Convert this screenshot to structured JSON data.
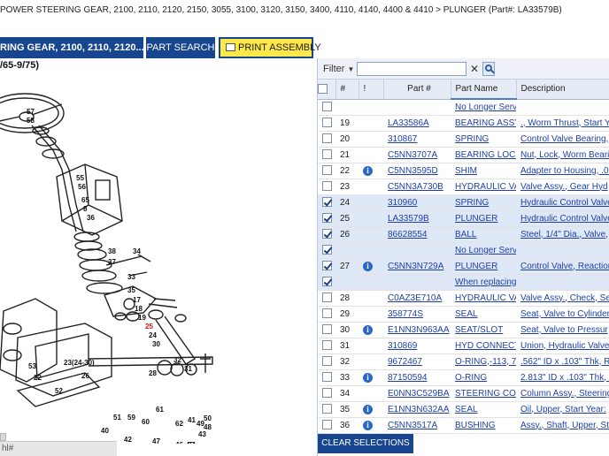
{
  "breadcrumb": "POWER STEERING GEAR, 2100, 2110, 2120, 2150, 3055, 3100, 3120, 3150, 3400, 4110, 4140, 4400 & 4410 > PLUNGER (Part#: LA33579B)",
  "toolbar": {
    "assembly_label": "RING GEAR, 2100, 2110, 2120...",
    "part_search_label": "PART SEARCH",
    "print_label": "PRINT ASSEMBLY"
  },
  "diagram": {
    "date_range": "/65-9/75)",
    "callouts": [
      "57",
      "58",
      "55",
      "56",
      "65",
      "8",
      "36",
      "38",
      "37",
      "34",
      "33",
      "35",
      "17",
      "18",
      "19",
      "25",
      "24",
      "30",
      "26",
      "23(24-30)",
      "32",
      "31",
      "28",
      "53",
      "22",
      "52",
      "61",
      "51",
      "59",
      "60",
      "62",
      "63",
      "41",
      "42",
      "47",
      "46",
      "45",
      "43",
      "49",
      "48",
      "50",
      "64",
      "40"
    ],
    "highlight_callout": "25",
    "scroll_text": "hl#"
  },
  "filter": {
    "label": "Filter",
    "placeholder": ""
  },
  "grid": {
    "columns": [
      "#",
      "!",
      "Part #",
      "Part Name",
      "Description"
    ],
    "rows": [
      {
        "checked": false,
        "num": "",
        "info": false,
        "part": "",
        "name": "No Longer Serv",
        "desc": "",
        "selected": false
      },
      {
        "checked": false,
        "num": "19",
        "info": false,
        "part": "LA33586A",
        "name": "BEARING ASSY",
        "desc": "., Worm Thrust, Start Y",
        "selected": false
      },
      {
        "checked": false,
        "num": "20",
        "info": false,
        "part": "310867",
        "name": "SPRING",
        "desc": "Control Valve Bearing, ",
        "selected": false
      },
      {
        "checked": false,
        "num": "21",
        "info": false,
        "part": "C5NN3707A",
        "name": "BEARING LOCK",
        "desc": "Nut, Lock, Worm Bearin",
        "selected": false
      },
      {
        "checked": false,
        "num": "22",
        "info": true,
        "part": "C5NN3595D",
        "name": "SHIM",
        "desc": "Adapter to Housing, .00",
        "selected": false
      },
      {
        "checked": false,
        "num": "23",
        "info": false,
        "part": "C5NN3A730B",
        "name": "HYDRAULIC VA",
        "desc": "Valve Assy., Gear Hyd",
        "selected": false
      },
      {
        "checked": true,
        "num": "24",
        "info": false,
        "part": "310960",
        "name": "SPRING",
        "desc": "Hydraulic Control Valve",
        "selected": true
      },
      {
        "checked": true,
        "num": "25",
        "info": false,
        "part": "LA33579B",
        "name": "PLUNGER",
        "desc": "Hydraulic Control Valve",
        "selected": true
      },
      {
        "checked": true,
        "num": "26",
        "info": false,
        "part": "86628554",
        "name": "BALL",
        "desc": "Steel, 1/4\" Dia., Valve, ",
        "selected": true
      },
      {
        "checked": true,
        "num": "",
        "info": false,
        "part": "",
        "name": "No Longer Serv",
        "desc": "",
        "selected": true
      },
      {
        "checked": true,
        "num": "27",
        "info": true,
        "part": "C5NN3N729A",
        "name": "PLUNGER",
        "desc": "Control Valve, Reaction",
        "selected": true
      },
      {
        "checked": true,
        "num": "",
        "info": false,
        "part": "",
        "name": "When replacing",
        "desc": "",
        "selected": true
      },
      {
        "checked": false,
        "num": "28",
        "info": false,
        "part": "C0AZ3E710A",
        "name": "HYDRAULIC VA",
        "desc": "Valve Assy., Check, Se",
        "selected": false
      },
      {
        "checked": false,
        "num": "29",
        "info": false,
        "part": "358774S",
        "name": "SEAL",
        "desc": "Seat, Valve to Cylinder",
        "selected": false
      },
      {
        "checked": false,
        "num": "30",
        "info": true,
        "part": "E1NN3N963AA",
        "name": "SEAT/SLOT",
        "desc": "Seat, Valve to Pressur",
        "selected": false
      },
      {
        "checked": false,
        "num": "31",
        "info": false,
        "part": "310869",
        "name": "HYD CONNECT",
        "desc": "Union, Hydraulic Valve",
        "selected": false
      },
      {
        "checked": false,
        "num": "32",
        "info": false,
        "part": "9672467",
        "name": "O-RING,-113, 7",
        "desc": ".562\" ID x .103\" Thk, Re",
        "selected": false
      },
      {
        "checked": false,
        "num": "33",
        "info": true,
        "part": "87150594",
        "name": "O-RING",
        "desc": "2.813\" ID x .103\" Thk, O",
        "selected": false
      },
      {
        "checked": false,
        "num": "34",
        "info": false,
        "part": "E0NN3C529BA",
        "name": "STEERING COL",
        "desc": "Column Assy., Steering",
        "selected": false
      },
      {
        "checked": false,
        "num": "35",
        "info": true,
        "part": "E1NN3N632AA",
        "name": "SEAL",
        "desc": "Oil, Upper, Start Year:",
        "selected": false
      },
      {
        "checked": false,
        "num": "36",
        "info": true,
        "part": "C5NN3517A",
        "name": "BUSHING",
        "desc": "Assy., Shaft, Upper, Sta",
        "selected": false
      }
    ]
  },
  "clear_label": "CLEAR SELECTIONS",
  "colors": {
    "accent": "#17458f",
    "print_button": "#ffe84a",
    "link": "#1f3fa8",
    "info": "#2a67c7"
  }
}
